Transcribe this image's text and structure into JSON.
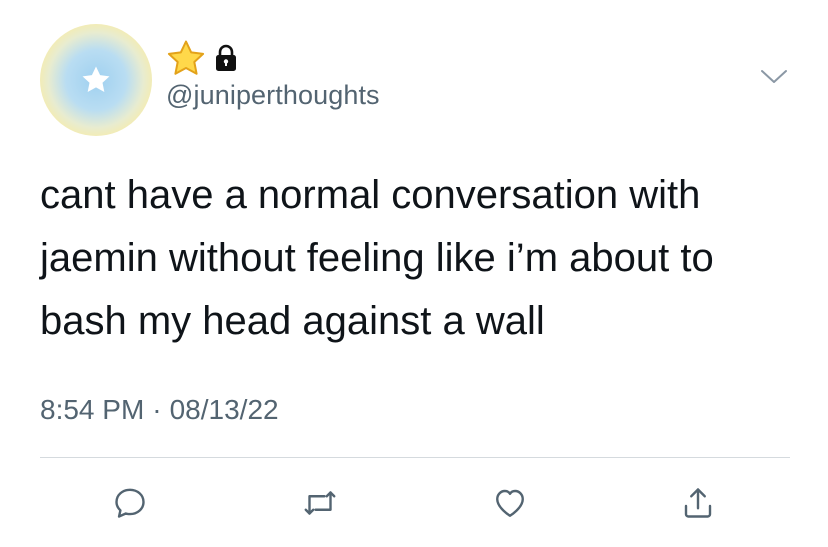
{
  "user": {
    "handle": "@juniperthoughts",
    "badges": [
      "star-icon",
      "lock-icon"
    ],
    "avatar": "star-avatar"
  },
  "tweet": {
    "text": "cant have a normal conversation with\njaemin without feeling like i’m about to\nbash my head against a wall",
    "time": "8:54 PM",
    "separator": "·",
    "date": "08/13/22"
  },
  "actions": [
    "reply-icon",
    "retweet-icon",
    "like-icon",
    "share-icon"
  ],
  "colors": {
    "text": "#0f1419",
    "secondary": "#536471",
    "divider": "#d5dade",
    "star_fill": "#ffd84a",
    "star_stroke": "#e3a21a"
  }
}
